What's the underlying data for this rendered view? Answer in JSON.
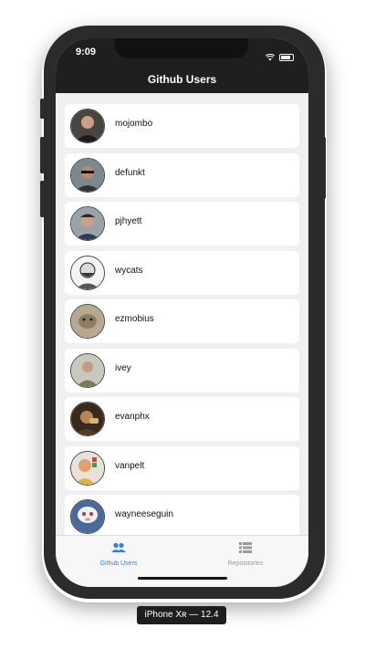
{
  "status_bar": {
    "time": "9:09"
  },
  "header": {
    "title": "Github Users"
  },
  "users": [
    {
      "login": "mojombo"
    },
    {
      "login": "defunkt"
    },
    {
      "login": "pjhyett"
    },
    {
      "login": "wycats"
    },
    {
      "login": "ezmobius"
    },
    {
      "login": "ivey"
    },
    {
      "login": "evanphx"
    },
    {
      "login": "vanpelt"
    },
    {
      "login": "wayneeseguin"
    }
  ],
  "tabs": [
    {
      "label": "Github Users",
      "icon": "people-icon",
      "active": true
    },
    {
      "label": "Repositories",
      "icon": "list-icon",
      "active": false
    }
  ],
  "colors": {
    "active_tab": "#2f7fe6",
    "inactive_tab": "#9a9a9a",
    "header_bg": "#1f1f1f"
  },
  "device_label": "iPhone Xʀ — 12.4"
}
